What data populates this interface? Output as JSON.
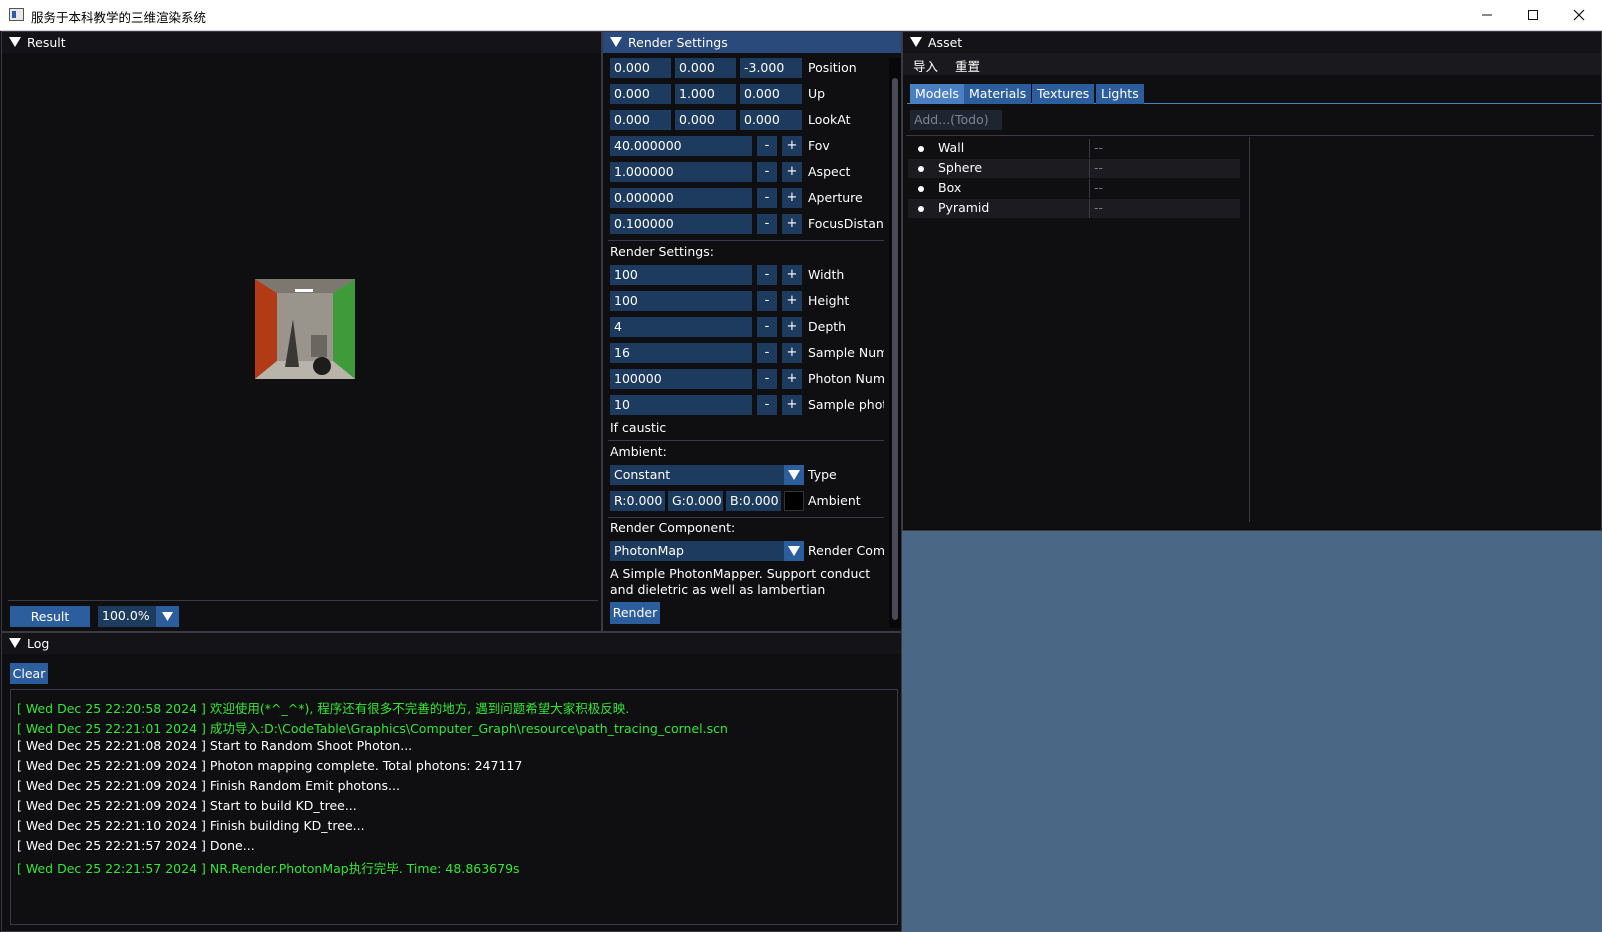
{
  "window": {
    "title": "服务于本科教学的三维渲染系统"
  },
  "result_panel": {
    "title": "Result",
    "bottom_button": "Result",
    "zoom": "100.0%"
  },
  "render_settings": {
    "title": "Render Settings",
    "camera": {
      "position": {
        "label": "Position",
        "values": [
          "0.000",
          "0.000",
          "-3.000"
        ]
      },
      "up": {
        "label": "Up",
        "values": [
          "0.000",
          "1.000",
          "0.000"
        ]
      },
      "lookat": {
        "label": "LookAt",
        "values": [
          "0.000",
          "0.000",
          "0.000"
        ]
      },
      "fov": {
        "label": "Fov",
        "value": "40.000000"
      },
      "aspect": {
        "label": "Aspect",
        "value": "1.000000"
      },
      "aperture": {
        "label": "Aperture",
        "value": "0.000000"
      },
      "focus": {
        "label": "FocusDistanc",
        "value": "0.100000"
      }
    },
    "section_render": "Render Settings:",
    "width": {
      "label": "Width",
      "value": "100"
    },
    "height": {
      "label": "Height",
      "value": "100"
    },
    "depth": {
      "label": "Depth",
      "value": "4"
    },
    "sample_num": {
      "label": "Sample Num",
      "value": "16"
    },
    "photon_num": {
      "label": "Photon Num",
      "value": "100000"
    },
    "sample_phot": {
      "label": "Sample phot",
      "value": "10"
    },
    "if_caustic": "If caustic",
    "section_ambient": "Ambient:",
    "ambient_type": {
      "label": "Type",
      "value": "Constant"
    },
    "ambient_color": {
      "label": "Ambient",
      "r": "R:0.000",
      "g": "G:0.000",
      "b": "B:0.000",
      "swatch": "#000000"
    },
    "section_component": "Render Component:",
    "component": {
      "label": "Render Comp",
      "value": "PhotonMap"
    },
    "description": [
      "A Simple PhotonMapper. Support conduct",
      "and dieletric as well as lambertian"
    ],
    "render_button": "Render",
    "minus": "-",
    "plus": "+"
  },
  "asset": {
    "title": "Asset",
    "menu": [
      "导入",
      "重置"
    ],
    "tabs": [
      "Models",
      "Materials",
      "Textures",
      "Lights"
    ],
    "add_button": "Add...(Todo)",
    "models": [
      {
        "name": "Wall",
        "value": "--"
      },
      {
        "name": "Sphere",
        "value": "--"
      },
      {
        "name": "Box",
        "value": "--"
      },
      {
        "name": "Pyramid",
        "value": "--"
      }
    ]
  },
  "log": {
    "title": "Log",
    "clear_button": "Clear",
    "lines": [
      {
        "text": "[ Wed Dec 25 22:20:58 2024 ] 欢迎使用(*^_^*), 程序还有很多不完善的地方, 遇到问题希望大家积极反映.",
        "color": "#33e633"
      },
      {
        "text": "[ Wed Dec 25 22:21:01 2024 ] 成功导入:D:\\CodeTable\\Graphics\\Computer_Graph\\resource\\path_tracing_cornel.scn",
        "color": "#33e633"
      },
      {
        "text": "[ Wed Dec 25 22:21:08 2024 ] Start to Random Shoot Photon...",
        "color": "#ffffff"
      },
      {
        "text": "[ Wed Dec 25 22:21:09 2024 ] Photon mapping complete. Total photons: 247117",
        "color": "#ffffff"
      },
      {
        "text": "[ Wed Dec 25 22:21:09 2024 ] Finish Random Emit photons...",
        "color": "#ffffff"
      },
      {
        "text": "[ Wed Dec 25 22:21:09 2024 ] Start to build KD_tree...",
        "color": "#ffffff"
      },
      {
        "text": "[ Wed Dec 25 22:21:10 2024 ] Finish building KD_tree...",
        "color": "#ffffff"
      },
      {
        "text": "[ Wed Dec 25 22:21:57 2024 ] Done...",
        "color": "#ffffff"
      },
      {
        "text": "[ Wed Dec 25 22:21:57 2024 ] NR.Render.PhotonMap执行完毕. Time: 48.863679s",
        "color": "#33e633"
      }
    ]
  },
  "colors": {
    "accent": "#294a7a",
    "field": "#1d3a5f",
    "tab": "#2c5e9e",
    "background_blue": "#4a6785",
    "log_green": "#33e633"
  }
}
